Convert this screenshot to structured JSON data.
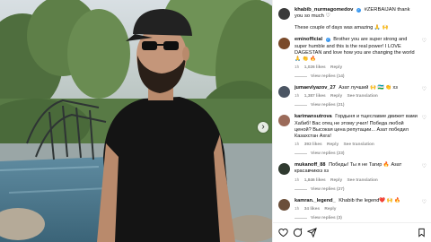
{
  "photo": {
    "alt": "",
    "carousel_next_glyph": "›"
  },
  "caption": {
    "username": "khabib_nurmagomedov",
    "text": "#ZERBAIJAN thank you so much ♡",
    "subtext": "These couple of days was amazing 🙏 🙌"
  },
  "comments": [
    {
      "username": "eminofficial",
      "verified": true,
      "avatar_color": "#7a4a2a",
      "text": "Brother you are super strong and super humble and this is the real power! I LOVE DAGESTAN and love how you are changing the world 🙏 👏 🔥",
      "time": "1h",
      "likes": "1,026 likes",
      "reply": "Reply",
      "view_replies": "View replies (14)"
    },
    {
      "username": "jumaevlyazov_27",
      "verified": false,
      "avatar_color": "#4b5563",
      "text": "Азат лучший 🙌 🇺🇿 👏 хз",
      "time": "1h",
      "likes": "1,387 likes",
      "reply": "Reply",
      "see_translation": "See translation",
      "view_replies": "View replies (21)"
    },
    {
      "username": "karimansutrova",
      "verified": false,
      "avatar_color": "#9b6b5a",
      "text": "Гордыня и тщеславие движет вами Хабиб! Вас отец не этому учил! Победа любой ценой? Высокая цена репутации... Азат победил Казахстан Ахга!",
      "time": "1h",
      "likes": "393 likes",
      "reply": "Reply",
      "see_translation": "See translation",
      "view_replies": "View replies (23)"
    },
    {
      "username": "mukanoff_88",
      "verified": false,
      "avatar_color": "#2f3a2f",
      "text": "Победы! Ты я не Тагир 🔥 Азат красавчикхз хз",
      "time": "1h",
      "likes": "1,846 likes",
      "reply": "Reply",
      "see_translation": "See translation",
      "view_replies": "View replies (27)"
    },
    {
      "username": "kamran._legend_",
      "verified": false,
      "avatar_color": "#6b4f3a",
      "text": "Khabib the legend❤️ 🙌 🔥",
      "time": "1h",
      "likes": "34 likes",
      "reply": "Reply",
      "view_replies": "View replies (3)"
    }
  ],
  "heart_glyph": "♡",
  "actions": {
    "like_label": "Like",
    "comment_label": "Comment",
    "share_label": "Share",
    "save_label": "Save"
  }
}
